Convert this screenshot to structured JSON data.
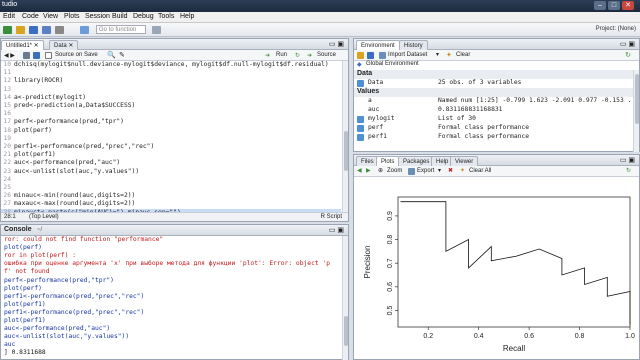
{
  "window": {
    "title": "tudio"
  },
  "menu": [
    "Edit",
    "Code",
    "View",
    "Plots",
    "Session",
    "Build",
    "Debug",
    "Tools",
    "Help"
  ],
  "toolbar": {
    "go_to_file": "Go to function",
    "project": "Project: (None)"
  },
  "editor": {
    "tabs": [
      "Untitled1*",
      "Data"
    ],
    "source_on_save": "Source on Save",
    "run": "Run",
    "source": "Source",
    "lines": [
      {
        "n": "10",
        "t": "dchisq(mylogit$null.deviance-mylogit$deviance, mylogit$df.null-mylogit$df.residual)"
      },
      {
        "n": "11",
        "t": ""
      },
      {
        "n": "12",
        "t": "library(ROCR)"
      },
      {
        "n": "13",
        "t": ""
      },
      {
        "n": "14",
        "t": "a<-predict(mylogit)"
      },
      {
        "n": "15",
        "t": "pred<-prediction(a,Data$SUCCESS)"
      },
      {
        "n": "16",
        "t": ""
      },
      {
        "n": "17",
        "t": "perf<-performance(pred,\"tpr\")"
      },
      {
        "n": "18",
        "t": "plot(perf)"
      },
      {
        "n": "19",
        "t": ""
      },
      {
        "n": "20",
        "t": "perf1<-performance(pred,\"prec\",\"rec\")"
      },
      {
        "n": "21",
        "t": "plot(perf1)"
      },
      {
        "n": "22",
        "t": "auc<-performance(pred,\"auc\")"
      },
      {
        "n": "23",
        "t": "auc<-unlist(slot(auc,\"y.values\"))"
      },
      {
        "n": "24",
        "t": ""
      },
      {
        "n": "25",
        "t": ""
      },
      {
        "n": "26",
        "t": "minauc<-min(round(auc,digits=2))"
      },
      {
        "n": "27",
        "t": "maxauc<-max(round(auc,digits=2))"
      },
      {
        "n": "28",
        "t": "minauct<-paste(c(\"min(AUC)=\"),minauc,sep=\"\")"
      },
      {
        "n": "29",
        "t": ""
      }
    ],
    "status_pos": "28:1",
    "status_scope": "(Top Level)",
    "status_lang": "R Script"
  },
  "console": {
    "title": "Console",
    "path": "~/",
    "lines": [
      {
        "c": "red",
        "t": "ror: could not find function \"performance\""
      },
      {
        "c": "blue",
        "t": "plot(perf)"
      },
      {
        "c": "red",
        "t": "ror in plot(perf) :"
      },
      {
        "c": "red",
        "t": "ошибка при оценке аргумента 'x' при выборе метода для функции 'plot': Error: object 'p"
      },
      {
        "c": "red",
        "t": "f' not found"
      },
      {
        "c": "blue",
        "t": "perf<-performance(pred,\"tpr\")"
      },
      {
        "c": "blue",
        "t": "plot(perf)"
      },
      {
        "c": "blue",
        "t": "perf1<-performance(pred,\"prec\",\"rec\")"
      },
      {
        "c": "blue",
        "t": "plot(perf1)"
      },
      {
        "c": "blue",
        "t": "perf1<-performance(pred,\"prec\",\"rec\")"
      },
      {
        "c": "blue",
        "t": "plot(perf1)"
      },
      {
        "c": "blue",
        "t": "auc<-performance(pred,\"auc\")"
      },
      {
        "c": "blue",
        "t": "auc<-unlist(slot(auc,\"y.values\"))"
      },
      {
        "c": "blue",
        "t": "auc"
      },
      {
        "c": "black",
        "t": "] 0.8311688"
      }
    ]
  },
  "environment": {
    "tabs": [
      "Environment",
      "History"
    ],
    "import": "Import Dataset",
    "clear": "Clear",
    "scope": "Global Environment",
    "data_header": "Data",
    "values_header": "Values",
    "data_rows": [
      {
        "name": "Data",
        "value": "25 obs. of 3 variables"
      }
    ],
    "value_rows": [
      {
        "name": "a",
        "value": "Named num [1:25] -0.799 1.623 -2.091 0.977 -0.153 ."
      },
      {
        "name": "auc",
        "value": "0.831168831168831"
      },
      {
        "name": "mylogit",
        "value": "List of 30"
      },
      {
        "name": "perf",
        "value": "Formal class performance"
      },
      {
        "name": "perf1",
        "value": "Formal class performance"
      }
    ]
  },
  "plots": {
    "tabs": [
      "Files",
      "Plots",
      "Packages",
      "Help",
      "Viewer"
    ],
    "zoom": "Zoom",
    "export": "Export",
    "clear_all": "Clear All"
  },
  "chart_data": {
    "type": "line",
    "xlabel": "Recall",
    "ylabel": "Precision",
    "xlim": [
      0.08,
      1.0
    ],
    "ylim": [
      0.43,
      0.98
    ],
    "x_ticks": [
      "0.2",
      "0.4",
      "0.6",
      "0.8",
      "1.0"
    ],
    "y_ticks": [
      "0.5",
      "0.6",
      "0.7",
      "0.8",
      "0.9"
    ],
    "series": [
      {
        "x": [
          0.09,
          0.27,
          0.27,
          0.27,
          0.36,
          0.36,
          0.45,
          0.45,
          0.55,
          0.64,
          0.73,
          0.73,
          0.82,
          0.82,
          0.91,
          0.91,
          1.0,
          1.0
        ],
        "y": [
          0.96,
          0.96,
          0.93,
          0.75,
          0.8,
          0.68,
          0.77,
          0.71,
          0.73,
          0.76,
          0.72,
          0.65,
          0.68,
          0.61,
          0.64,
          0.56,
          0.58,
          0.44
        ]
      }
    ]
  }
}
